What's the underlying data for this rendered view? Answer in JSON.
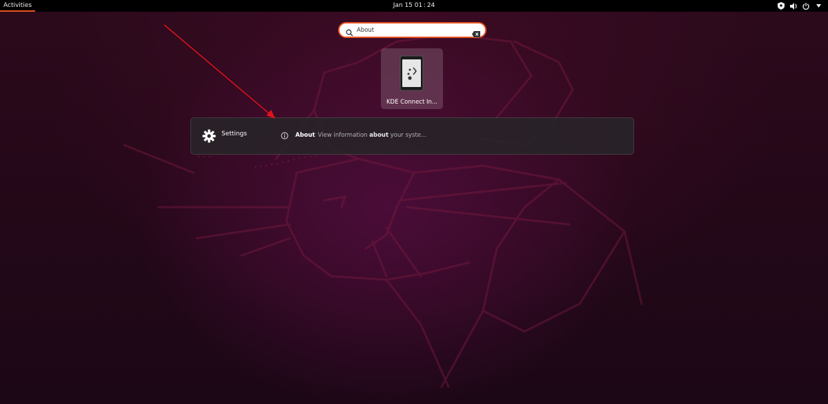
{
  "topbar": {
    "activities_label": "Activities",
    "clock": "Jan 15  01 : 24",
    "tray_icons": [
      "network-icon",
      "volume-icon",
      "power-icon"
    ]
  },
  "search": {
    "value": "About",
    "icon": "search-icon",
    "clear_icon": "clear-icon"
  },
  "app_results": [
    {
      "label": "KDE Connect In...",
      "icon": "kde-connect-icon"
    }
  ],
  "providers": [
    {
      "name": "Settings",
      "icon": "gear-icon",
      "results": [
        {
          "icon": "info-icon",
          "title": "About",
          "description_pre": "View information ",
          "description_match": "about",
          "description_post": " your syste..."
        }
      ]
    }
  ],
  "colors": {
    "accent": "#e95420",
    "annotation_arrow": "#e0121b",
    "topbar": "#000000"
  }
}
